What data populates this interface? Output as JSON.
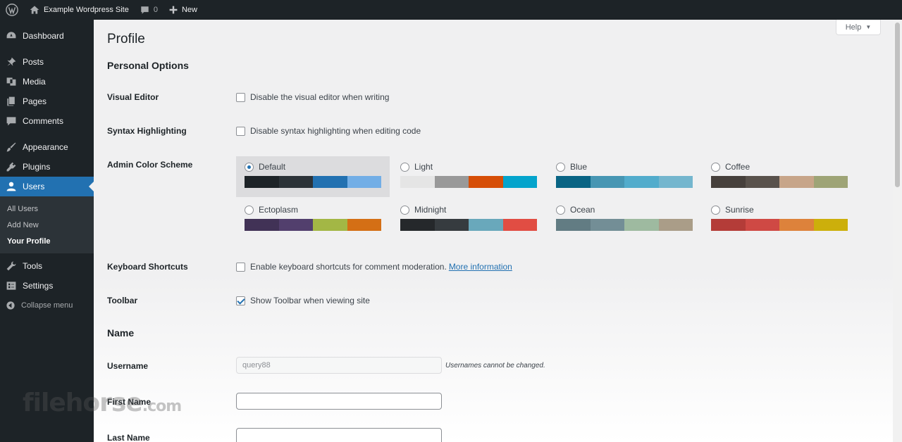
{
  "adminbar": {
    "site_name": "Example Wordpress Site",
    "comments_count": "0",
    "new_label": "New"
  },
  "sidebar": {
    "items": [
      {
        "label": "Dashboard",
        "icon": "dashboard-icon"
      },
      {
        "label": "Posts",
        "icon": "pin-icon"
      },
      {
        "label": "Media",
        "icon": "media-icon"
      },
      {
        "label": "Pages",
        "icon": "pages-icon"
      },
      {
        "label": "Comments",
        "icon": "comment-icon"
      },
      {
        "label": "Appearance",
        "icon": "brush-icon"
      },
      {
        "label": "Plugins",
        "icon": "plugin-icon"
      },
      {
        "label": "Users",
        "icon": "user-icon"
      }
    ],
    "submenu": [
      "All Users",
      "Add New",
      "Your Profile"
    ],
    "bottom_items": [
      {
        "label": "Tools",
        "icon": "wrench-icon"
      },
      {
        "label": "Settings",
        "icon": "settings-icon"
      }
    ],
    "collapse_label": "Collapse menu"
  },
  "help_label": "Help",
  "page_title": "Profile",
  "personal_options": {
    "heading": "Personal Options",
    "visual_editor_label": "Visual Editor",
    "visual_editor_text": "Disable the visual editor when writing",
    "syntax_label": "Syntax Highlighting",
    "syntax_text": "Disable syntax highlighting when editing code",
    "color_scheme_label": "Admin Color Scheme",
    "keyboard_label": "Keyboard Shortcuts",
    "keyboard_text": "Enable keyboard shortcuts for comment moderation.",
    "keyboard_link": "More information",
    "toolbar_label": "Toolbar",
    "toolbar_text": "Show Toolbar when viewing site"
  },
  "color_schemes": [
    {
      "name": "Default",
      "colors": [
        "#1d2327",
        "#2c3338",
        "#2271b1",
        "#72aee6"
      ]
    },
    {
      "name": "Light",
      "colors": [
        "#e5e5e5",
        "#999999",
        "#d64e07",
        "#04a4cc"
      ]
    },
    {
      "name": "Blue",
      "colors": [
        "#096484",
        "#4796b3",
        "#52accc",
        "#74b6ce"
      ]
    },
    {
      "name": "Coffee",
      "colors": [
        "#46403c",
        "#59524c",
        "#c7a589",
        "#9ea476"
      ]
    },
    {
      "name": "Ectoplasm",
      "colors": [
        "#413256",
        "#523f6d",
        "#a3b745",
        "#d46f15"
      ]
    },
    {
      "name": "Midnight",
      "colors": [
        "#25282b",
        "#363b3f",
        "#69a8bb",
        "#e14d43"
      ]
    },
    {
      "name": "Ocean",
      "colors": [
        "#627c83",
        "#738e96",
        "#9ebaa0",
        "#aa9d88"
      ]
    },
    {
      "name": "Sunrise",
      "colors": [
        "#b43c38",
        "#cf4944",
        "#dd823b",
        "#ccaf0b"
      ]
    }
  ],
  "name_section": {
    "heading": "Name",
    "username_label": "Username",
    "username_value": "query88",
    "username_desc": "Usernames cannot be changed.",
    "first_name_label": "First Name",
    "first_name_value": "",
    "last_name_label": "Last Name",
    "last_name_value": ""
  },
  "watermark": {
    "main": "filehorse",
    "suffix": ".com"
  }
}
